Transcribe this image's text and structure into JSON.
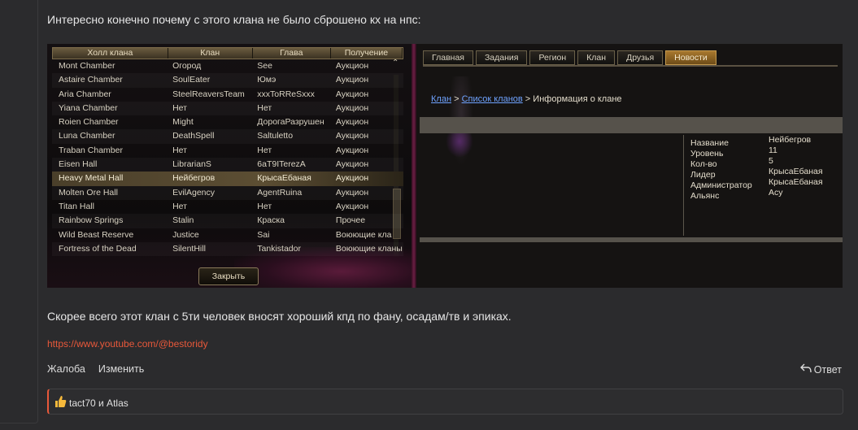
{
  "post": {
    "text_top": "Интересно конечно почему с этого клана не было сброшено кх на нпс:",
    "text_bottom": "Скорее всего этот клан с 5ти человек вносят хороший кпд по фану, осадам/тв и эпиках.",
    "signature_link": "https://www.youtube.com/@bestoridy"
  },
  "hall_window": {
    "columns": [
      "Холл клана",
      "Клан",
      "Глава",
      "Получение"
    ],
    "rows": [
      [
        "Mont Chamber",
        "Огород",
        "See",
        "Аукцион"
      ],
      [
        "Astaire Chamber",
        "SoulEater",
        "Юмэ",
        "Аукцион"
      ],
      [
        "Aria Chamber",
        "SteelReaversTeam",
        "xxxToRReSxxx",
        "Аукцион"
      ],
      [
        "Yiana Chamber",
        "Нет",
        "Нет",
        "Аукцион"
      ],
      [
        "Roien Chamber",
        "Might",
        "ДорогаРазрушен",
        "Аукцион"
      ],
      [
        "Luna Chamber",
        "DeathSpell",
        "Saltuletto",
        "Аукцион"
      ],
      [
        "Traban Chamber",
        "Нет",
        "Нет",
        "Аукцион"
      ],
      [
        "Eisen Hall",
        "LibrarianS",
        "6aT9ITerezA",
        "Аукцион"
      ],
      [
        "Heavy Metal Hall",
        "Нейбегров",
        "КрысаЕбаная",
        "Аукцион"
      ],
      [
        "Molten Ore Hall",
        "EvilAgency",
        "AgentRuina",
        "Аукцион"
      ],
      [
        "Titan Hall",
        "Нет",
        "Нет",
        "Аукцион"
      ],
      [
        "Rainbow Springs",
        "Stalin",
        "Краска",
        "Прочее"
      ],
      [
        "Wild Beast Reserve",
        "Justice",
        "Sai",
        "Воюющие кла"
      ],
      [
        "Fortress of the Dead",
        "SilentHill",
        "Tankistador",
        "Воюющие кланы"
      ]
    ],
    "selected_row": 8,
    "close_label": "Закрыть"
  },
  "clan_window": {
    "tabs": [
      "Главная",
      "Задания",
      "Регион",
      "Клан",
      "Друзья",
      "Новости"
    ],
    "active_tab": "Новости",
    "breadcrumb": {
      "link1": "Клан",
      "sep1": " > ",
      "link2": "Список кланов",
      "sep2": " > ",
      "current": "Информация о клане"
    },
    "info": [
      {
        "k": "Название",
        "v": "Нейбегров"
      },
      {
        "k": "Уровень",
        "v": "11"
      },
      {
        "k": "Кол-во",
        "v": "5"
      },
      {
        "k": "Лидер",
        "v": "КрысаЕбаная"
      },
      {
        "k": "Администратор",
        "v": "КрысаЕбаная"
      },
      {
        "k": "Альянс",
        "v": "Асу"
      }
    ]
  },
  "actions": {
    "report": "Жалоба",
    "edit": "Изменить",
    "reply": "Ответ"
  },
  "reactions": {
    "text": "tact70 и Atlas",
    "icon": "thumbs-up-icon"
  },
  "colors": {
    "accent": "#e8583a",
    "link_blue": "#6fa3ff",
    "active_tab": "#a8782e"
  }
}
